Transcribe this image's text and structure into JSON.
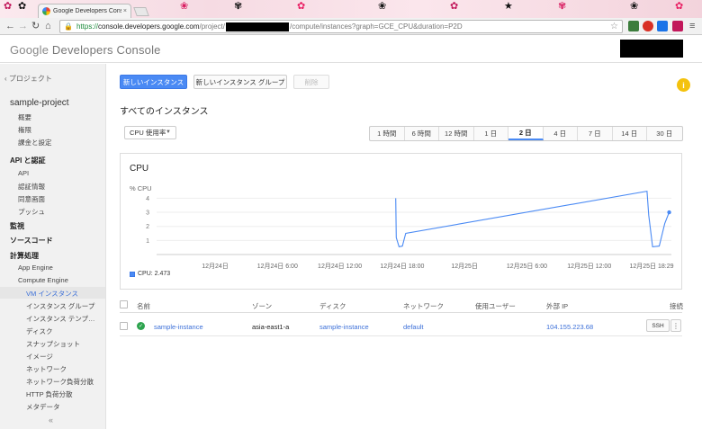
{
  "browser": {
    "tab_title": "Google Developers Conso",
    "tab_close": "×",
    "url_scheme": "https://",
    "url_host": "console.developers.google.com",
    "url_path_prefix": "/project/",
    "url_path_suffix": "/compute/instances?graph=GCE_CPU&duration=P2D",
    "nav_back": "←",
    "nav_forward": "→",
    "nav_reload": "↻",
    "nav_home": "⌂",
    "bookmark": "☆",
    "menu": "≡"
  },
  "header": {
    "logo_google": "Google",
    "logo_product": " Developers Console"
  },
  "sidebar": {
    "back": "‹ プロジェクト",
    "project": "sample-project",
    "project_items": [
      "概要",
      "権限",
      "課金と設定"
    ],
    "api_heading": "API と認証",
    "api_items": [
      "API",
      "認証情報",
      "同意画面",
      "プッシュ"
    ],
    "monitoring": "監視",
    "source": "ソースコード",
    "compute": "計算処理",
    "app_engine": "App Engine",
    "compute_engine": "Compute Engine",
    "ce_items": [
      "VM インスタンス",
      "インスタンス グループ",
      "インスタンス テンプ…",
      "ディスク",
      "スナップショット",
      "イメージ",
      "ネットワーク",
      "ネットワーク負荷分散",
      "HTTP 負荷分散",
      "メタデータ"
    ],
    "collapse": "«"
  },
  "toolbar": {
    "new_instance": "新しいインスタンス",
    "new_group": "新しいインスタンス グループ",
    "delete": "削除",
    "info": "i"
  },
  "page_title": "すべてのインスタンス",
  "metric_select": {
    "value": "CPU 使用率",
    "caret": "▼"
  },
  "time_ranges": [
    "1 時間",
    "6 時間",
    "12 時間",
    "1 日",
    "2 日",
    "4 日",
    "7 日",
    "14 日",
    "30 日"
  ],
  "time_range_selected": 4,
  "chart_data": {
    "type": "line",
    "title": "CPU",
    "ylabel": "% CPU",
    "yticks": [
      1,
      2,
      3,
      4
    ],
    "ylim": [
      0,
      4.6
    ],
    "xticks": [
      "12月24日",
      "12月24日 6:00",
      "12月24日 12:00",
      "12月24日 18:00",
      "12月25日",
      "12月25日 6:00",
      "12月25日 12:00",
      "12月25日 18:29"
    ],
    "xlim": [
      0,
      46.5
    ],
    "series": [
      {
        "name": "CPU: 2.473",
        "x": [
          21.6,
          21.65,
          21.9,
          22.2,
          22.5,
          44.3,
          44.45,
          44.8,
          45.4,
          45.9,
          46.3
        ],
        "y": [
          4.0,
          1.2,
          0.55,
          0.6,
          1.5,
          4.5,
          2.8,
          0.55,
          0.6,
          2.2,
          3.0
        ],
        "end_marker": true
      }
    ],
    "grid": true,
    "legend_position": "bottom-left",
    "color": "#4a8af4"
  },
  "table": {
    "headers": {
      "name": "名前",
      "zone": "ゾーン",
      "disk": "ディスク",
      "network": "ネットワーク",
      "user": "使用ユーザー",
      "external_ip": "外部 IP",
      "connect": "接続"
    },
    "rows": [
      {
        "name": "sample-instance",
        "zone": "asia-east1-a",
        "disk": "sample-instance",
        "network": "default",
        "user": "",
        "external_ip": "104.155.223.68",
        "ssh": "SSH",
        "more": "⋮",
        "status_icon": "✓"
      }
    ]
  }
}
